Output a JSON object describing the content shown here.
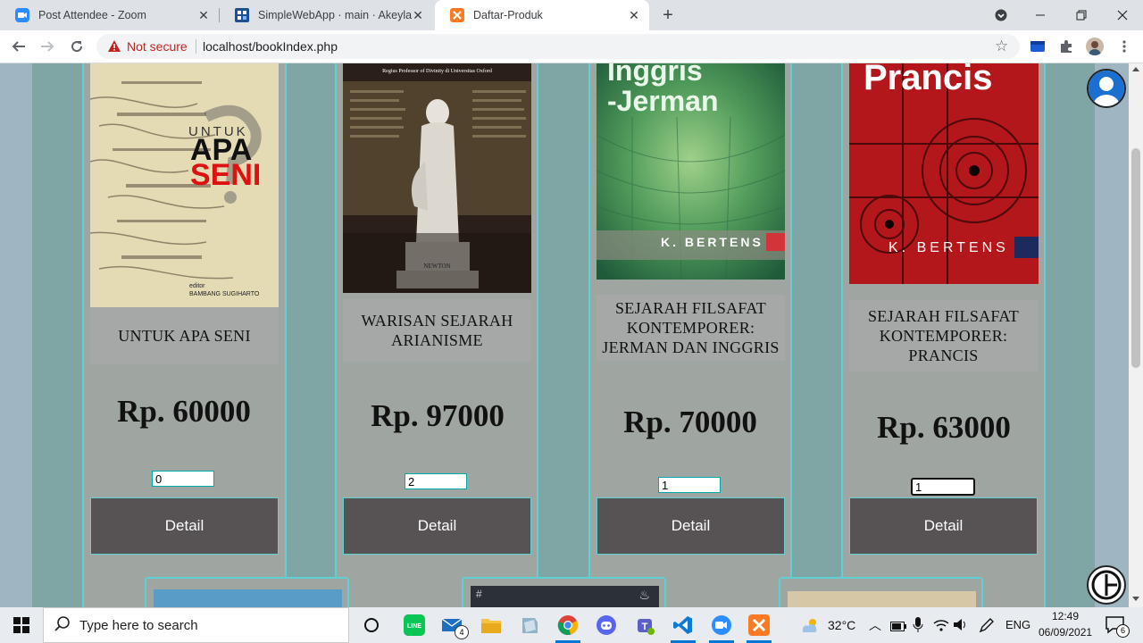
{
  "browser": {
    "tabs": [
      {
        "title": "Post Attendee - Zoom",
        "icon": "zoom-icon"
      },
      {
        "title": "SimpleWebApp · main · Akeyla N",
        "icon": "azure-devops-icon"
      },
      {
        "title": "Daftar-Produk",
        "icon": "xampp-icon",
        "active": true
      }
    ],
    "new_tab_label": "+",
    "security_label": "Not secure",
    "url": "localhost/bookIndex.php"
  },
  "products": [
    {
      "title": "UNTUK APA SENI",
      "price": "Rp. 60000",
      "qty": "0",
      "detail": "Detail",
      "cover": {
        "line1": "UNTUK",
        "line2": "APA",
        "line3": "SENI",
        "editor": "editor",
        "editor_name": "BAMBANG SUGIHARTO"
      }
    },
    {
      "title": "WARISAN SEJARAH ARIANISME",
      "price": "Rp. 97000",
      "qty": "2",
      "detail": "Detail",
      "cover": {
        "header": "Regius Professor of Divinity di Universitas Oxford",
        "plaque": "NEWTON"
      }
    },
    {
      "title": "SEJARAH FILSAFAT KONTEMPORER: JERMAN DAN INGGRIS",
      "price": "Rp. 70000",
      "qty": "1",
      "detail": "Detail",
      "cover": {
        "line1": "Inggris",
        "line2": "-Jerman",
        "author": "K. BERTENS"
      }
    },
    {
      "title": "SEJARAH FILSAFAT KONTEMPORER: PRANCIS",
      "price": "Rp. 63000",
      "qty": "1",
      "detail": "Detail",
      "cover": {
        "line1": "Prancis",
        "author": "K. BERTENS"
      }
    }
  ],
  "taskbar": {
    "search_placeholder": "Type here to search",
    "mail_badge": "4",
    "weather": "32°C",
    "language": "ENG",
    "time": "12:49",
    "date": "06/09/2021",
    "notification_count": "6"
  }
}
